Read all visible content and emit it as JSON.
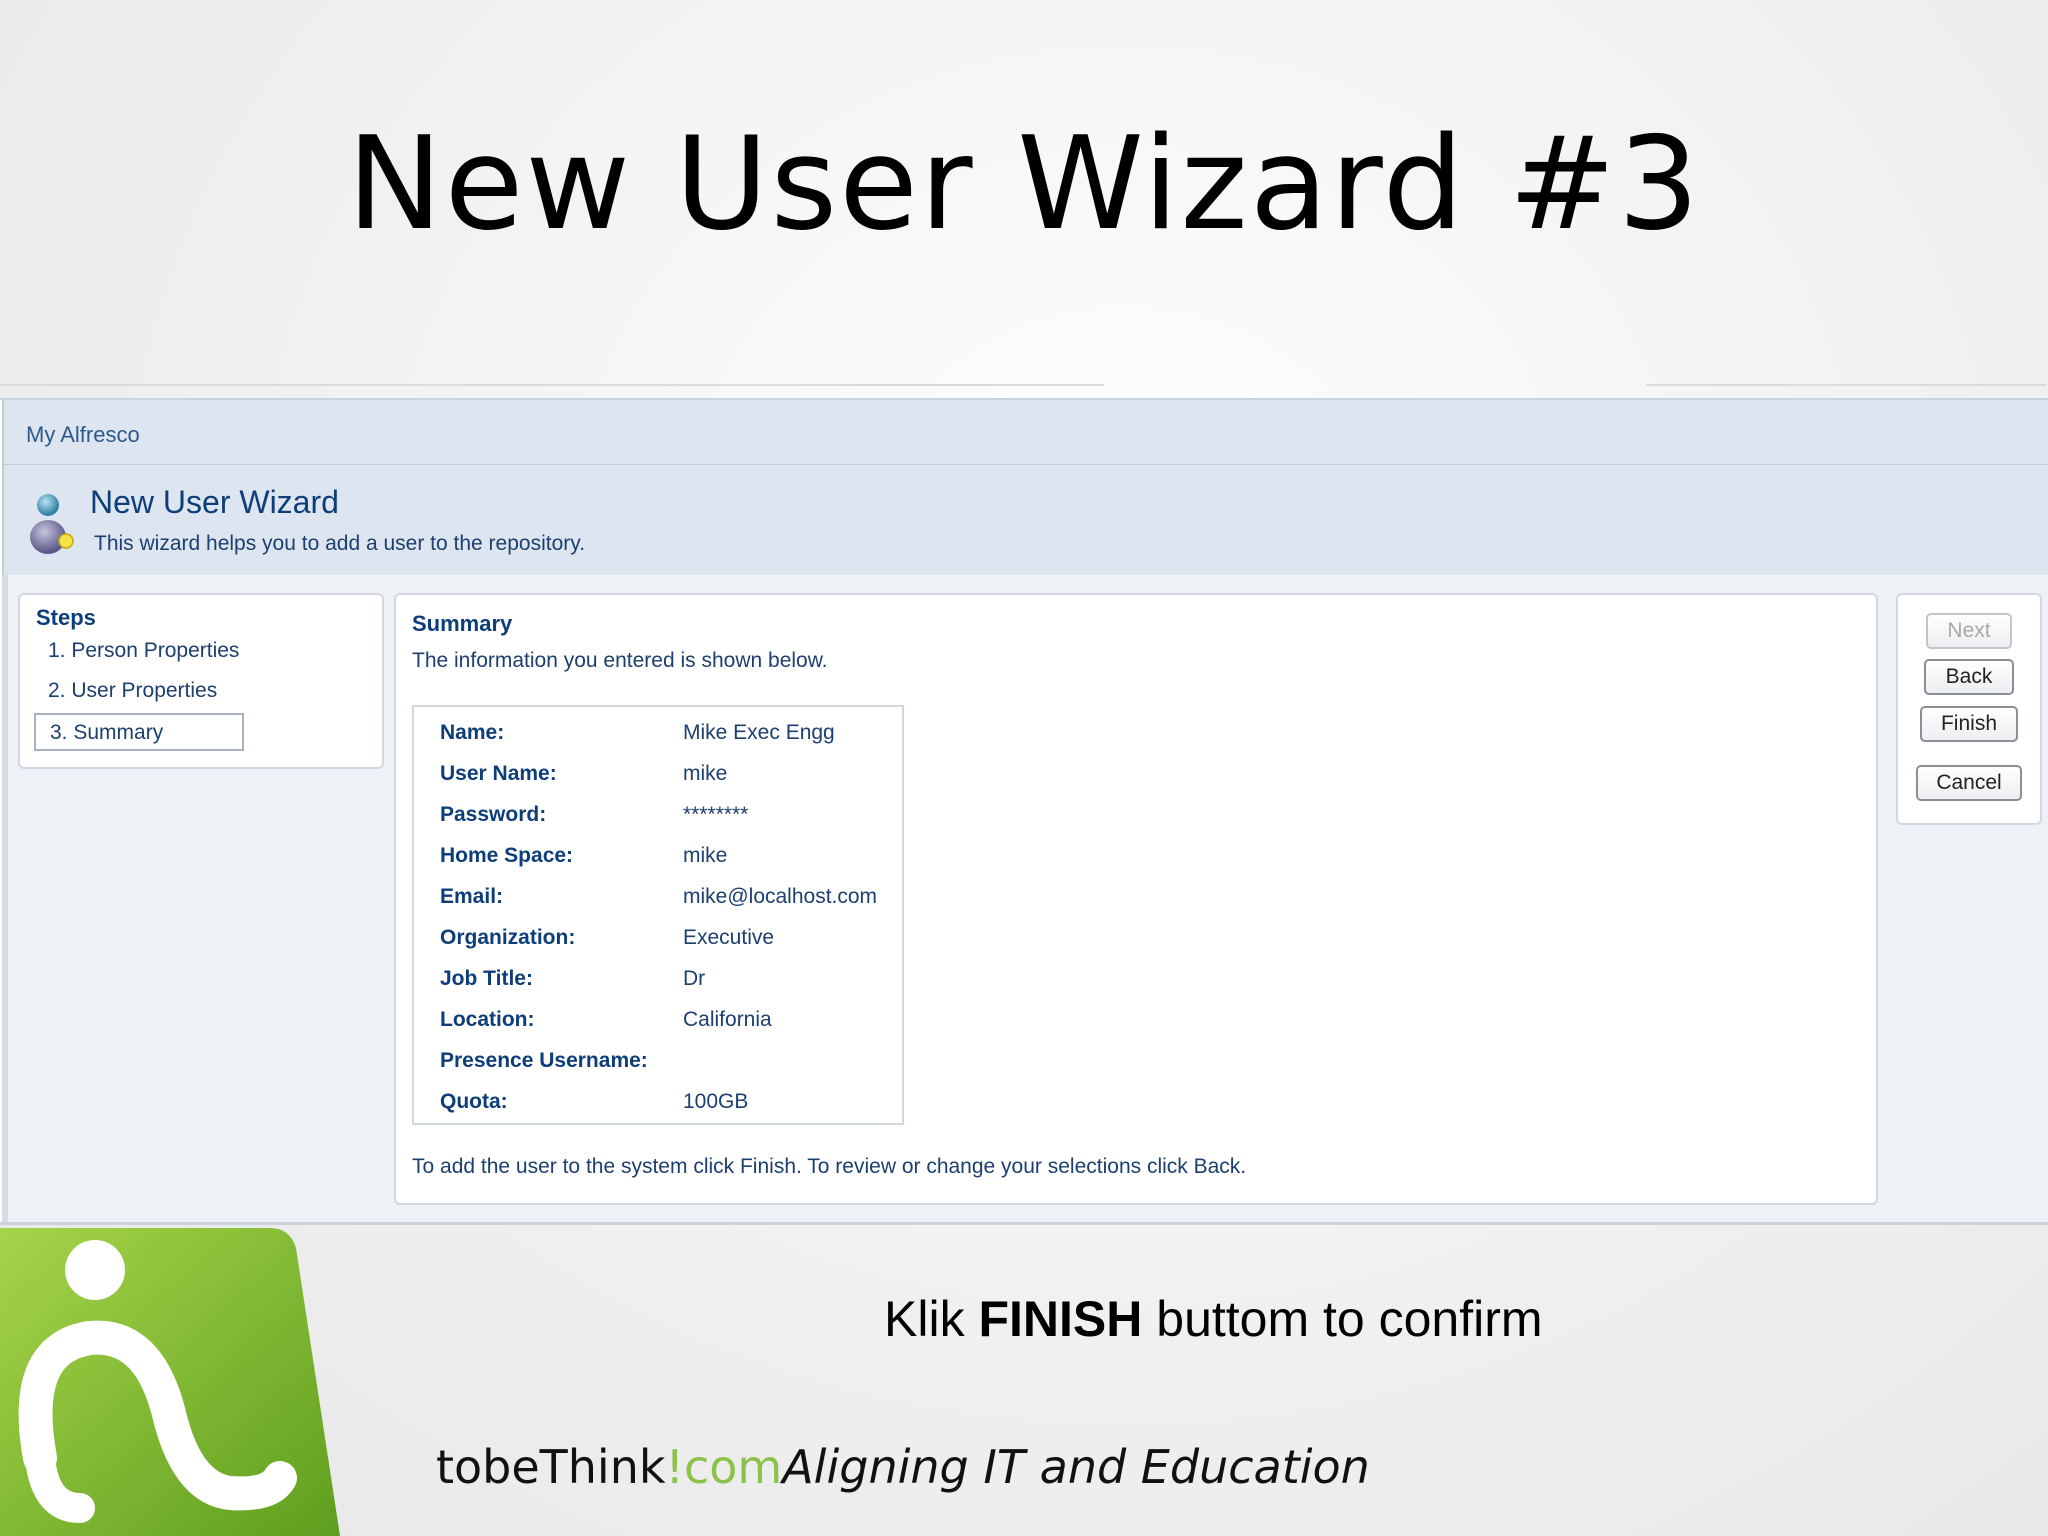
{
  "slide": {
    "title": "New User Wizard #3",
    "caption_prefix": "Klik ",
    "caption_bold": "FINISH",
    "caption_suffix": " buttom to confirm"
  },
  "app": {
    "breadcrumb": "My Alfresco",
    "wizard_title": "New User Wizard",
    "wizard_subtitle": "This wizard helps you to add a user to the repository."
  },
  "steps": {
    "title": "Steps",
    "items": [
      {
        "label": "1. Person Properties"
      },
      {
        "label": "2. User Properties"
      },
      {
        "label": "3. Summary",
        "active": true
      }
    ]
  },
  "summary": {
    "title": "Summary",
    "subtitle": "The information you entered is shown below.",
    "rows": [
      {
        "label": "Name:",
        "value": "Mike Exec Engg"
      },
      {
        "label": "User Name:",
        "value": "mike"
      },
      {
        "label": "Password:",
        "value": "********"
      },
      {
        "label": "Home Space:",
        "value": "mike"
      },
      {
        "label": "Email:",
        "value": "mike@localhost.com"
      },
      {
        "label": "Organization:",
        "value": "Executive"
      },
      {
        "label": "Job Title:",
        "value": "Dr"
      },
      {
        "label": "Location:",
        "value": "California"
      },
      {
        "label": "Presence Username:",
        "value": ""
      },
      {
        "label": "Quota:",
        "value": "100GB"
      }
    ],
    "footer": "To add the user to the system click Finish. To review or change your selections click Back."
  },
  "actions": {
    "next": "Next",
    "back": "Back",
    "finish": "Finish",
    "cancel": "Cancel"
  },
  "branding": {
    "site_name": "tobeThink",
    "site_mark": "!",
    "site_tld": "com",
    "slogan": "Aligning IT and Education"
  },
  "colors": {
    "link_blue": "#0e3e7a",
    "header_bg": "#dde6f0",
    "brand_green": "#8bc34a"
  }
}
